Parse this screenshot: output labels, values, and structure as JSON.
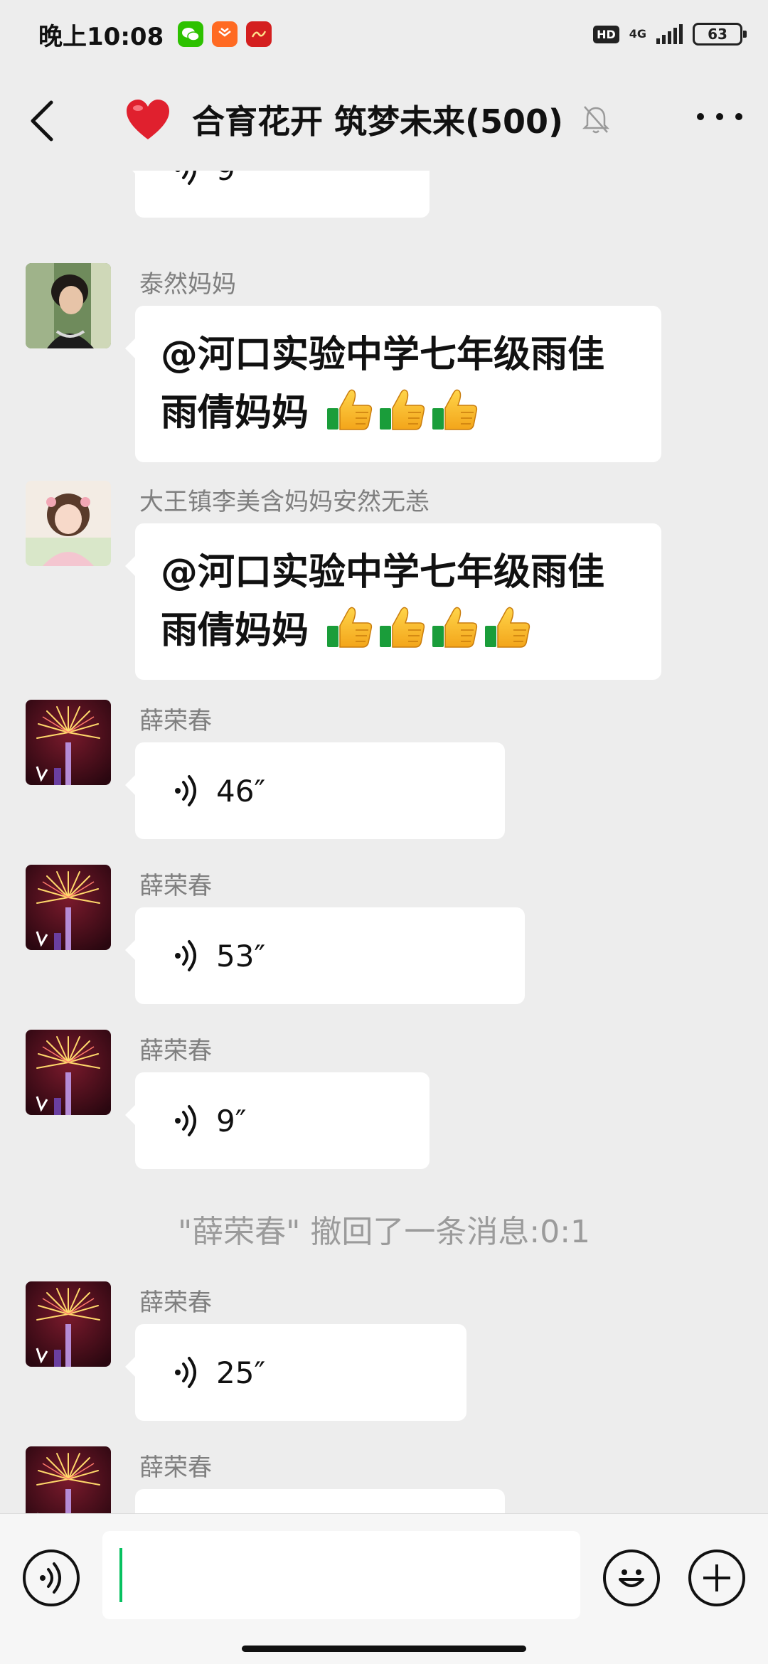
{
  "status_bar": {
    "time": "晚上10:08",
    "app_icons": [
      {
        "name": "wechat-icon",
        "color": "#2dc100",
        "glyph": "●"
      },
      {
        "name": "taobao-icon",
        "color": "#ff6a22",
        "glyph": "✉"
      },
      {
        "name": "xuexi-icon",
        "color": "#d41f1f",
        "glyph": "学"
      }
    ],
    "hd": "HD",
    "network": "4G",
    "battery": "63"
  },
  "header": {
    "title": "合育花开 筑梦未来(500)",
    "muted": true
  },
  "messages": [
    {
      "type": "voice",
      "sender": "",
      "duration": "9″",
      "avatar": "fireworks"
    },
    {
      "type": "text",
      "sender": "泰然妈妈",
      "text": "@河口实验中学七年级雨佳雨倩妈妈",
      "thumbs": 3,
      "avatar": "woman-photo"
    },
    {
      "type": "text",
      "sender": "大王镇李美含妈妈安然无恙",
      "text": "@河口实验中学七年级雨佳雨倩妈妈",
      "thumbs": 4,
      "avatar": "girl-photo"
    },
    {
      "type": "voice",
      "sender": "薛荣春",
      "duration": "46″",
      "avatar": "fireworks"
    },
    {
      "type": "voice",
      "sender": "薛荣春",
      "duration": "53″",
      "avatar": "fireworks"
    },
    {
      "type": "voice",
      "sender": "薛荣春",
      "duration": "9″",
      "avatar": "fireworks"
    },
    {
      "type": "system",
      "text": "\"薛荣春\" 撤回了一条消息:0:1"
    },
    {
      "type": "voice",
      "sender": "薛荣春",
      "duration": "25″",
      "avatar": "fireworks"
    },
    {
      "type": "voice",
      "sender": "薛荣春",
      "duration": "",
      "avatar": "fireworks"
    }
  ],
  "input_bar": {
    "value": "",
    "voice_button": "voice-mode-icon",
    "emoji_button": "emoji-icon",
    "plus_button": "plus-icon"
  },
  "colors": {
    "background": "#ededed",
    "bubble": "#ffffff",
    "accent": "#07c160",
    "sender": "#7f7f7f"
  }
}
